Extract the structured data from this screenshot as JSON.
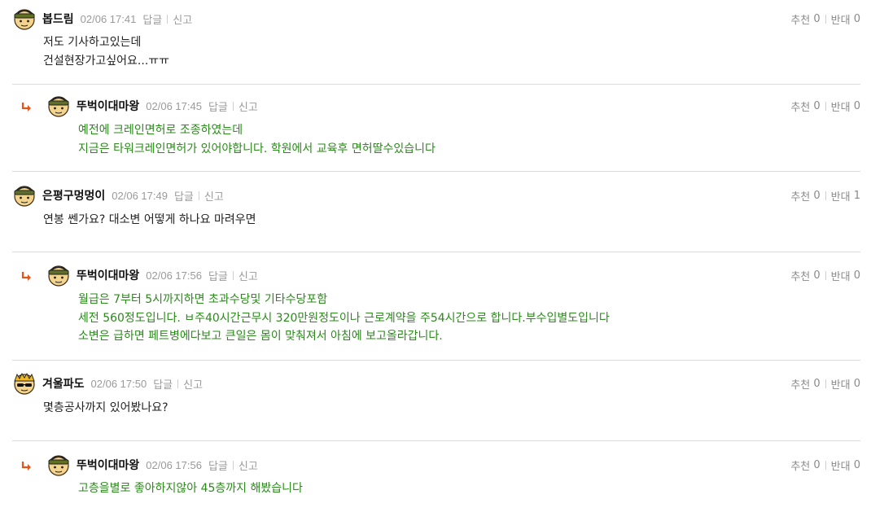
{
  "actions": {
    "reply_label": "답글",
    "report_label": "신고"
  },
  "votes": {
    "up_label": "추천",
    "down_label": "반대"
  },
  "colors": {
    "reply_text": "#2a8a1a",
    "arrow": "#e0561d",
    "meta": "#9a9a9a"
  },
  "icons": {
    "reply_arrow": "reply-arrow-icon",
    "avatar": "avatar-icon",
    "avatar_alt": "avatar-sunglasses-icon"
  },
  "comments": [
    {
      "nick": "봅드림",
      "date": "02/06 17:41",
      "up": "0",
      "down": "0",
      "is_reply": false,
      "lines": [
        "저도 기사하고있는데",
        "건설현장가고싶어요...ㅠㅠ"
      ]
    },
    {
      "nick": "뚜벅이대마왕",
      "date": "02/06 17:45",
      "up": "0",
      "down": "0",
      "is_reply": true,
      "lines": [
        "예전에 크레인면허로 조종하였는데",
        "지금은 타워크레인면허가 있어야합니다. 학원에서 교육후 면허딸수있습니다"
      ]
    },
    {
      "nick": "은평구멍멍이",
      "date": "02/06 17:49",
      "up": "0",
      "down": "1",
      "is_reply": false,
      "lines": [
        "연봉 쎈가요? 대소변 어떻게 하나요 마려우면"
      ]
    },
    {
      "nick": "뚜벅이대마왕",
      "date": "02/06 17:56",
      "up": "0",
      "down": "0",
      "is_reply": true,
      "lines": [
        "월급은 7부터 5시까지하면 초과수당및 기타수당포함",
        "세전 560정도입니다. ㅂ주40시간근무시 320만원정도이나 근로계약을 주54시간으로 합니다.부수입별도입니다",
        "소변은 급하면 페트병에다보고 큰일은 몸이 맞춰져서 아침에 보고올라갑니다."
      ]
    },
    {
      "nick": "겨울파도",
      "date": "02/06 17:50",
      "up": "0",
      "down": "0",
      "is_reply": false,
      "lines": [
        "몇층공사까지 있어봤나요?"
      ]
    },
    {
      "nick": "뚜벅이대마왕",
      "date": "02/06 17:56",
      "up": "0",
      "down": "0",
      "is_reply": true,
      "lines": [
        "고층을별로 좋아하지않아 45층까지 해봤습니다"
      ]
    }
  ]
}
